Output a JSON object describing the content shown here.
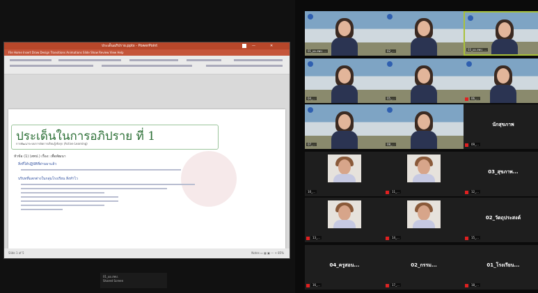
{
  "ppt": {
    "window_title": "ประเด็นอภิปราย.pptx - PowerPoint",
    "menu": "File   Home   Insert   Draw   Design   Transitions   Animations   Slide Show   Review   View   Help",
    "status_left": "Slide 1 of 5",
    "status_right": "Notes   ▭   ▦   ▣   —   +   85%"
  },
  "slide": {
    "title": "ประเด็นในการอภิปราย ที่ 1",
    "subtitle": "การพัฒนาระบบการจัดการเรียนรู้เชิงรุก (Active Learning)",
    "section_label": "หัวข้อ (1) (สพป.) เรื่อง: เพื่อพัฒนา",
    "bullet_1": "สิ่งที่ได้ปฏิบัติที่ผ่านมาแล้ว",
    "bullet_2": "บริบทที่แตกต่างในกลุ่มโรงเรียน สิ่งทำไว"
  },
  "share": {
    "name_chip_line1": "01_ผอ.สพป.",
    "name_chip_line2": "Shared Screen"
  },
  "gallery": [
    {
      "name": "01_ผอ.สพป. ...",
      "type": "cam",
      "muted": false
    },
    {
      "name": "02_...",
      "type": "cam",
      "muted": false
    },
    {
      "name": "03_ผอ.สพป. ...",
      "type": "cam",
      "muted": false,
      "active": true
    },
    {
      "name": "04_...",
      "type": "cam",
      "muted": false
    },
    {
      "name": "05_...",
      "type": "cam",
      "muted": false
    },
    {
      "name": "06_...",
      "type": "cam",
      "muted": true
    },
    {
      "name": "07_...",
      "type": "cam",
      "muted": false
    },
    {
      "name": "08_...",
      "type": "cam",
      "muted": false
    },
    {
      "name": "09_...",
      "type": "name",
      "big": "นักสุขภาพ",
      "muted": true
    },
    {
      "name": "10_...",
      "type": "photo",
      "muted": false
    },
    {
      "name": "11_...",
      "type": "photo",
      "muted": true
    },
    {
      "name": "12_...",
      "type": "name",
      "big": "03_สุขภาพ...",
      "muted": true
    },
    {
      "name": "13_...",
      "type": "photo",
      "muted": true
    },
    {
      "name": "14_...",
      "type": "photo",
      "muted": true
    },
    {
      "name": "15_...",
      "type": "name",
      "big": "02_วัตถุประสงค์",
      "muted": true
    },
    {
      "name": "16_...",
      "type": "name",
      "big": "04_ครูสอน...",
      "muted": true
    },
    {
      "name": "17_...",
      "type": "name",
      "big": "02_กรรม...",
      "muted": true
    },
    {
      "name": "18_...",
      "type": "name",
      "big": "01_โรงเรียน...",
      "muted": true
    }
  ],
  "footer": "..."
}
